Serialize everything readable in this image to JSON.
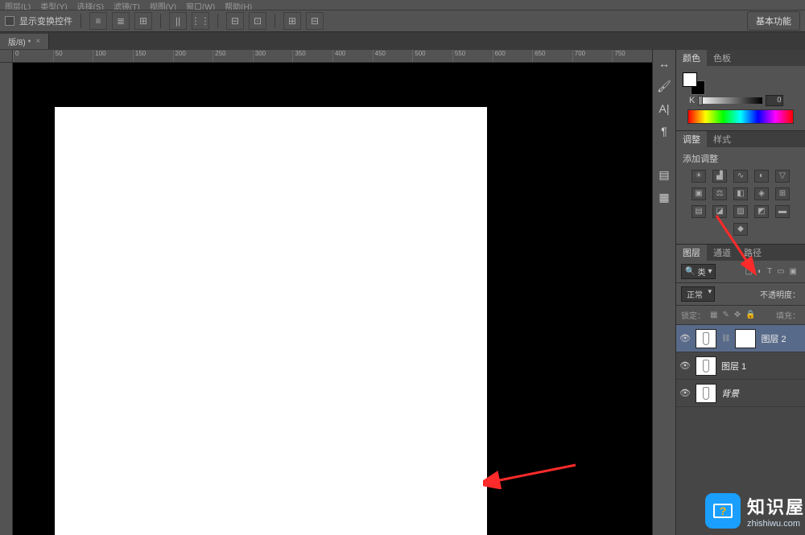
{
  "menu": [
    "图层(L)",
    "类型(Y)",
    "选择(S)",
    "滤镜(T)",
    "视图(V)",
    "窗口(W)",
    "帮助(H)"
  ],
  "options": {
    "show_transform": "显示变换控件"
  },
  "workspace_button": "基本功能",
  "doc_tab": {
    "name": "版/8) *",
    "close": "×"
  },
  "ruler_marks": [
    "0",
    "50",
    "100",
    "150",
    "200",
    "250",
    "300",
    "350",
    "400",
    "450",
    "500",
    "550",
    "600",
    "650",
    "700",
    "750"
  ],
  "panels": {
    "color": {
      "tab1": "颜色",
      "tab2": "色板",
      "k_label": "K",
      "k_value": "0"
    },
    "adjust": {
      "tab1": "调整",
      "tab2": "样式",
      "title": "添加调整"
    },
    "layers": {
      "tab1": "图层",
      "tab2": "通道",
      "tab3": "路径",
      "kind_label": "类",
      "mode": "正常",
      "opacity_label": "不透明度：",
      "lock_label": "锁定：",
      "fill_label": "填充：",
      "items": [
        {
          "name": "图层 2",
          "has_mask": true
        },
        {
          "name": "图层 1",
          "has_mask": false
        },
        {
          "name": "背景",
          "has_mask": false,
          "italic": true
        }
      ]
    }
  },
  "watermark": {
    "cn": "知识屋",
    "url": "zhishiwu.com"
  }
}
